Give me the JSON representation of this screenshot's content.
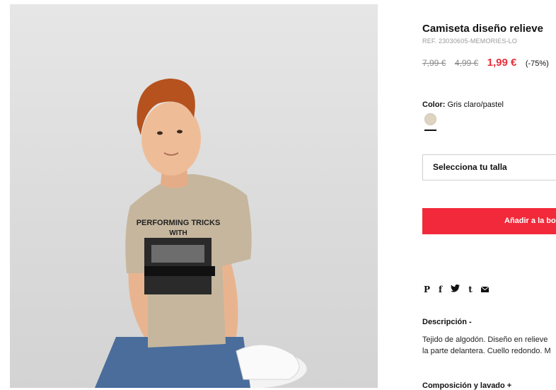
{
  "product": {
    "title": "Camiseta diseño relieve",
    "ref": "REF. 23030605-MEMORIES-LO",
    "prices": {
      "original": "7,99 €",
      "previous": "4,99 €",
      "current": "1,99 €",
      "discount": "(-75%)"
    },
    "color": {
      "label": "Color:",
      "value": "Gris claro/pastel",
      "swatch_color": "#dfd4c2"
    },
    "size_select": {
      "placeholder": "Selecciona tu talla"
    },
    "add_button": {
      "label": "Añadir a la bolsa"
    },
    "share_icons": [
      "pinterest-icon",
      "facebook-icon",
      "twitter-icon",
      "tumblr-icon",
      "mail-icon"
    ],
    "description": {
      "title": "Descripción -",
      "line1": "Tejido de algodón. Diseño en relieve",
      "line2": "la parte delantera. Cuello redondo. M"
    },
    "composition": {
      "title": "Composición y lavado +"
    }
  },
  "photo": {
    "shirt_text_line1": "PERFORMING TRICKS",
    "shirt_text_line2": "WITH"
  },
  "colors": {
    "accent": "#f2293a",
    "sale_price": "#e8303c"
  }
}
